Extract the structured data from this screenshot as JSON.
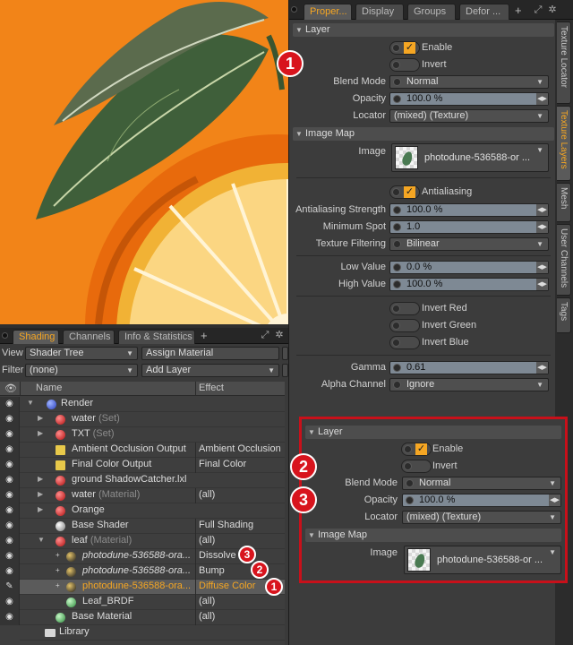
{
  "shading_panel": {
    "tabs": [
      {
        "label": "Shading",
        "active": true
      },
      {
        "label": "Channels",
        "active": false
      },
      {
        "label": "Info & Statistics",
        "active": false
      }
    ],
    "add_tab": "+",
    "view_label": "View",
    "view_value": "Shader Tree",
    "assign_material": "Assign Material",
    "filter_label": "Filter",
    "filter_value": "(none)",
    "add_layer": "Add Layer",
    "columns": {
      "name": "Name",
      "effect": "Effect"
    },
    "rows": [
      {
        "name": "Render",
        "sub": "",
        "effect": "",
        "icon": "render-icon"
      },
      {
        "name": "water",
        "sub": "(Set)",
        "effect": "",
        "icon": "material-icon"
      },
      {
        "name": "TXT",
        "sub": "(Set)",
        "effect": "",
        "icon": "material-icon"
      },
      {
        "name": "Ambient Occlusion Output",
        "sub": "",
        "effect": "Ambient Occlusion",
        "icon": "output-icon"
      },
      {
        "name": "Final Color Output",
        "sub": "",
        "effect": "Final Color",
        "icon": "output-icon"
      },
      {
        "name": "ground ShadowCatcher.lxl",
        "sub": "",
        "effect": "",
        "icon": "material-icon"
      },
      {
        "name": "water",
        "sub": "(Material)",
        "effect": "(all)",
        "icon": "material-icon"
      },
      {
        "name": "Orange",
        "sub": "",
        "effect": "",
        "icon": "material-icon"
      },
      {
        "name": "Base Shader",
        "sub": "",
        "effect": "Full Shading",
        "icon": "shader-icon"
      },
      {
        "name": "leaf",
        "sub": "(Material)",
        "effect": "(all)",
        "icon": "material-icon"
      },
      {
        "name": "photodune-536588-ora...",
        "sub": "",
        "effect": "Dissolve",
        "icon": "image-layer-icon"
      },
      {
        "name": "photodune-536588-ora...",
        "sub": "",
        "effect": "Bump",
        "icon": "image-layer-icon"
      },
      {
        "name": "photodune-536588-ora...",
        "sub": "",
        "effect": "Diffuse Color",
        "icon": "image-layer-icon"
      },
      {
        "name": "Leaf_BRDF",
        "sub": "",
        "effect": "(all)",
        "icon": "brdf-icon"
      },
      {
        "name": "Base Material",
        "sub": "",
        "effect": "(all)",
        "icon": "base-material-icon"
      },
      {
        "name": "Library",
        "sub": "",
        "effect": "",
        "icon": "folder-icon"
      }
    ],
    "badges": [
      "3",
      "2",
      "1"
    ]
  },
  "properties_panel": {
    "tabs": [
      {
        "label": "Proper...",
        "active": true
      },
      {
        "label": "Display",
        "active": false
      },
      {
        "label": "Groups",
        "active": false
      },
      {
        "label": "Defor ...",
        "active": false
      }
    ],
    "side_tabs": [
      "Texture Locator",
      "Texture Layers",
      "Mesh",
      "User Channels",
      "Tags"
    ],
    "layer_section": "Layer",
    "enable": "Enable",
    "invert": "Invert",
    "blend_mode_label": "Blend Mode",
    "blend_mode_value": "Normal",
    "opacity_label": "Opacity",
    "opacity_value": "100.0 %",
    "locator_label": "Locator",
    "locator_value": "(mixed) (Texture)",
    "image_map_section": "Image Map",
    "image_label": "Image",
    "image_value": "photodune-536588-or ...",
    "antialiasing": "Antialiasing",
    "aa_strength_label": "Antialiasing Strength",
    "aa_strength_value": "100.0 %",
    "min_spot_label": "Minimum Spot",
    "min_spot_value": "1.0",
    "tex_filter_label": "Texture Filtering",
    "tex_filter_value": "Bilinear",
    "low_label": "Low Value",
    "low_value": "0.0 %",
    "high_label": "High Value",
    "high_value": "100.0 %",
    "invert_red": "Invert Red",
    "invert_green": "Invert Green",
    "invert_blue": "Invert Blue",
    "gamma_label": "Gamma",
    "gamma_value": "0.61",
    "alpha_label": "Alpha Channel",
    "alpha_value": "Ignore",
    "badge": "1"
  },
  "zoom_box": {
    "layer_section": "Layer",
    "enable": "Enable",
    "invert": "Invert",
    "blend_mode_label": "Blend Mode",
    "blend_mode_value": "Normal",
    "opacity_label": "Opacity",
    "opacity_value": "100.0 %",
    "locator_label": "Locator",
    "locator_value": "(mixed) (Texture)",
    "image_map_section": "Image Map",
    "image_label": "Image",
    "image_value": "photodune-536588-or ...",
    "badges": [
      "2",
      "3"
    ]
  },
  "colors": {
    "accent": "#f5a623",
    "highlight_border": "#c8101a",
    "badge": "#d8141d",
    "viewport_bg": "#f28418"
  }
}
